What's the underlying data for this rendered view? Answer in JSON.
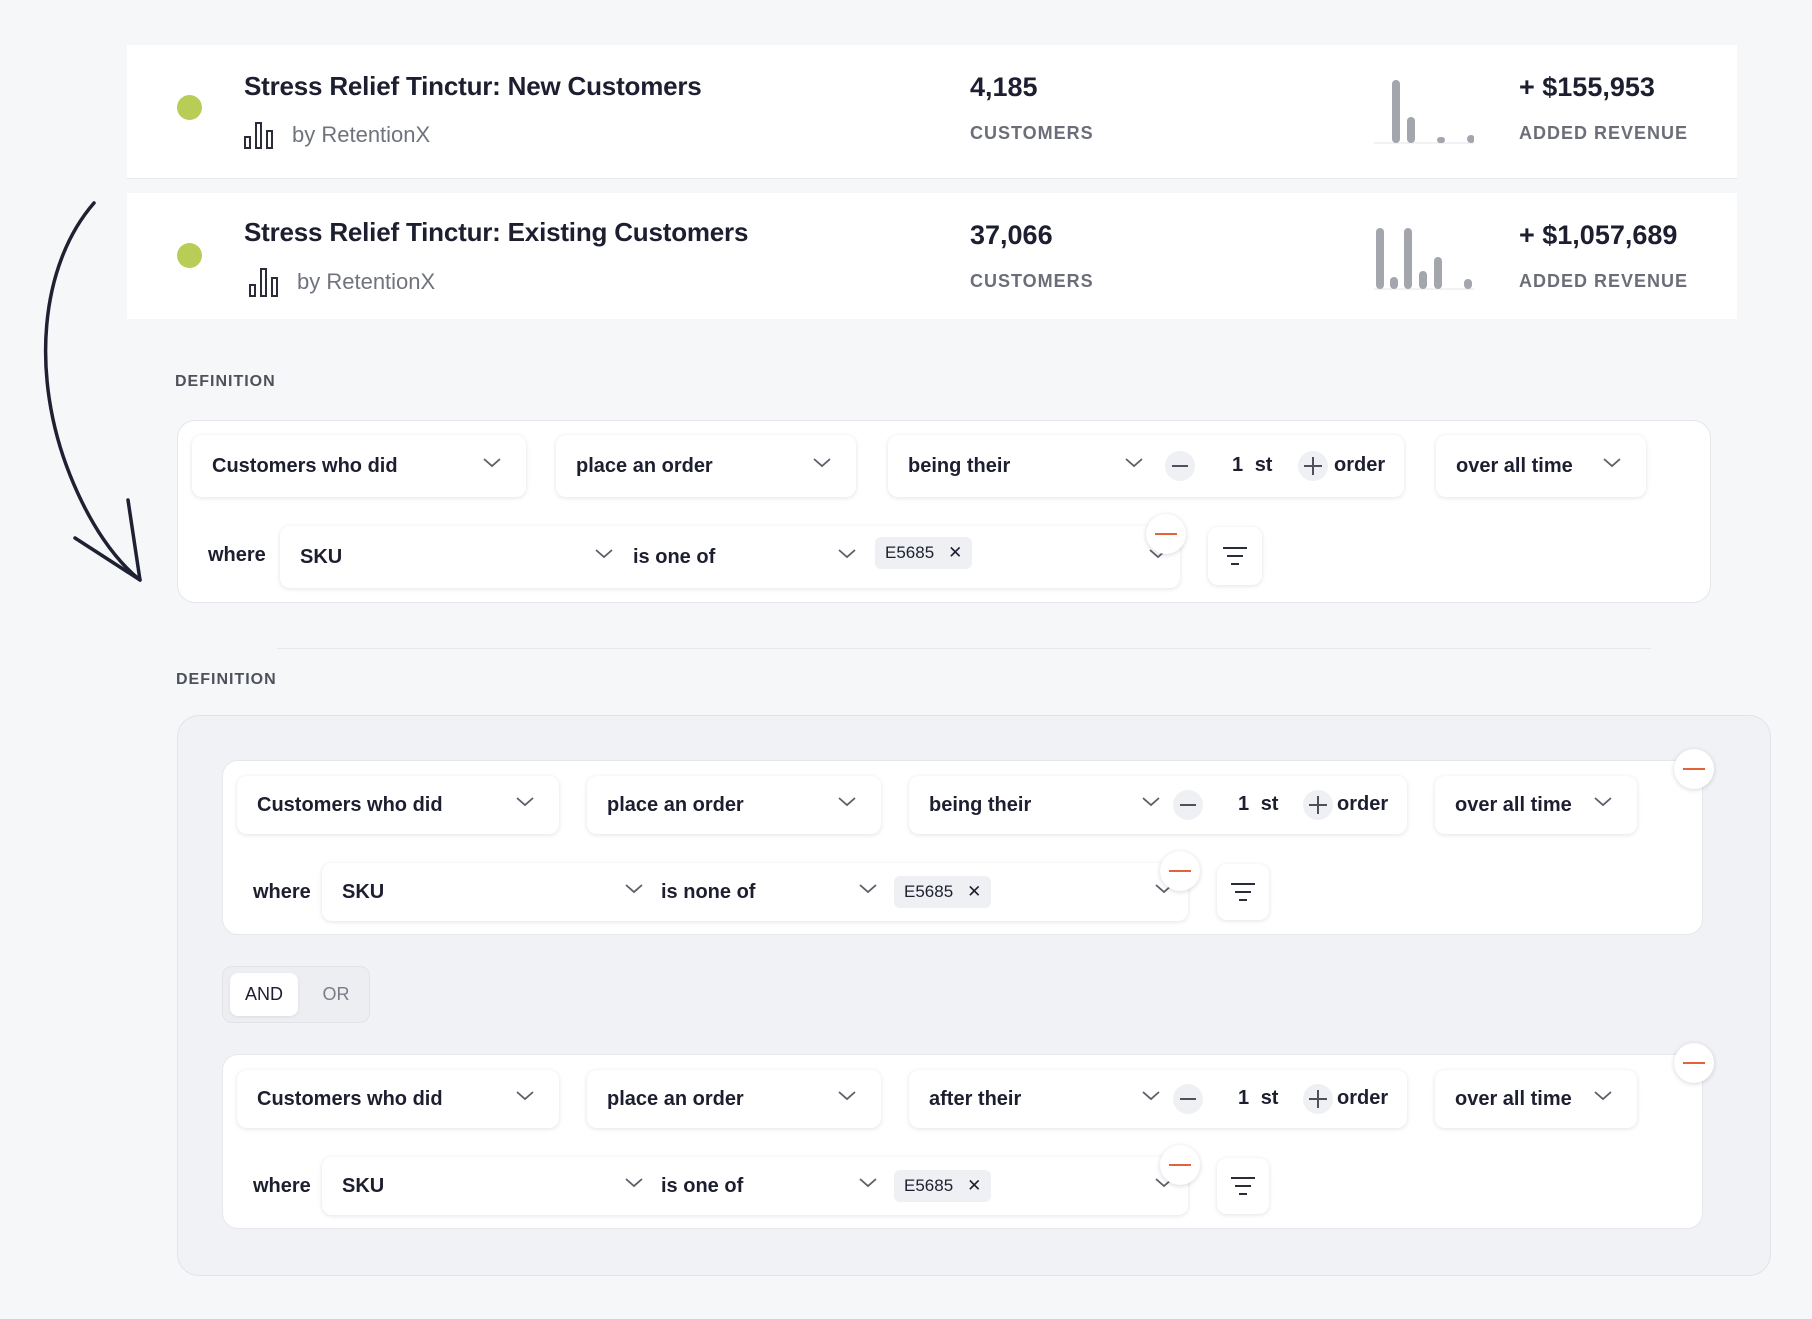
{
  "segments": [
    {
      "title": "Stress Relief Tinctur: New Customers",
      "by": "by RetentionX",
      "customers": "4,185",
      "customers_label": "CUSTOMERS",
      "revenue": "+ $155,953",
      "revenue_label": "ADDED REVENUE",
      "status_color": "#b8cd55"
    },
    {
      "title": "Stress Relief Tinctur: Existing Customers",
      "by": "by RetentionX",
      "customers": "37,066",
      "customers_label": "CUSTOMERS",
      "revenue": "+ $1,057,689",
      "revenue_label": "ADDED REVENUE",
      "status_color": "#b8cd55"
    }
  ],
  "definition_1": {
    "label": "DEFINITION",
    "rule": {
      "subject": "Customers who did",
      "action": "place an order",
      "relation": "being their",
      "ordinal_number": "1",
      "ordinal_suffix": "st",
      "order_word": "order",
      "timeframe": "over all time",
      "where_label": "where",
      "field": "SKU",
      "operator": "is one of",
      "tag": "E5685"
    }
  },
  "definition_2": {
    "label": "DEFINITION",
    "rules": [
      {
        "subject": "Customers who did",
        "action": "place an order",
        "relation": "being their",
        "ordinal_number": "1",
        "ordinal_suffix": "st",
        "order_word": "order",
        "timeframe": "over all time",
        "where_label": "where",
        "field": "SKU",
        "operator": "is none of",
        "tag": "E5685"
      },
      {
        "subject": "Customers who did",
        "action": "place an order",
        "relation": "after their",
        "ordinal_number": "1",
        "ordinal_suffix": "st",
        "order_word": "order",
        "timeframe": "over all time",
        "where_label": "where",
        "field": "SKU",
        "operator": "is one of",
        "tag": "E5685"
      }
    ],
    "logic_toggle": {
      "and_label": "AND",
      "or_label": "OR",
      "selected": "AND"
    }
  },
  "colors": {
    "status_green": "#b8cd55",
    "remove_red": "#e2643d",
    "text_dark": "#1d1f30"
  }
}
